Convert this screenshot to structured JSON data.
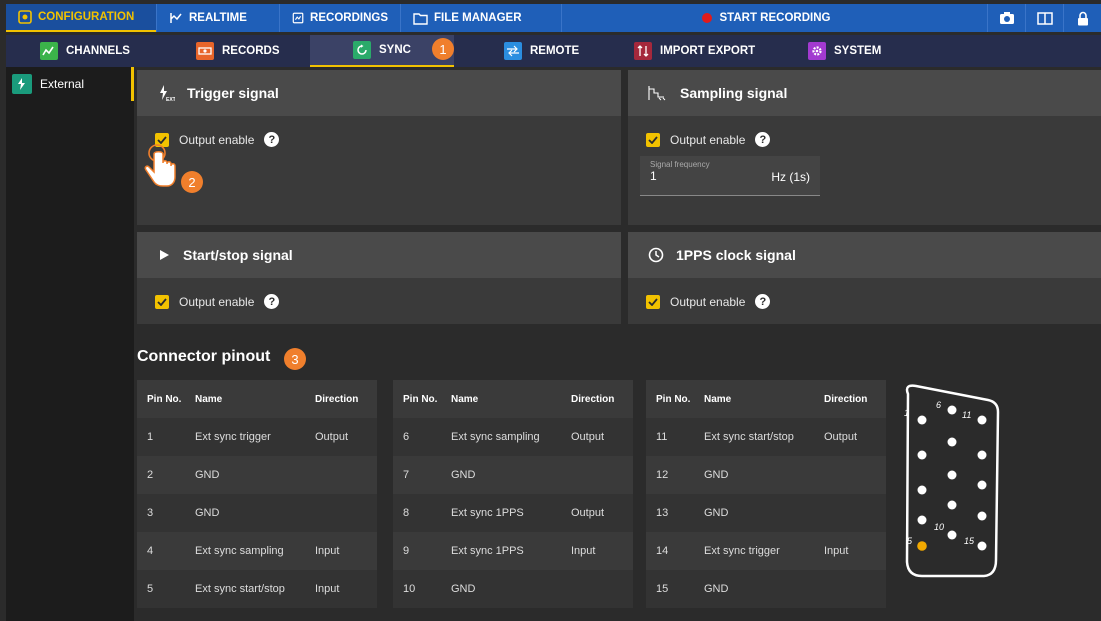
{
  "topnav": {
    "tabs": [
      {
        "label": "CONFIGURATION",
        "icon": "gear-box-icon"
      },
      {
        "label": "REALTIME",
        "icon": "realtime-icon"
      },
      {
        "label": "RECORDINGS",
        "icon": "recordings-icon"
      },
      {
        "label": "FILE MANAGER",
        "icon": "folder-icon"
      }
    ],
    "record_label": "START RECORDING",
    "right_icons": [
      "camera-icon",
      "book-icon",
      "lock-icon"
    ]
  },
  "subnav": {
    "tabs": [
      {
        "label": "CHANNELS",
        "icon": "channels-icon",
        "color": "#3bb34a"
      },
      {
        "label": "RECORDS",
        "icon": "records-icon",
        "color": "#e8652a"
      },
      {
        "label": "SYNC",
        "icon": "sync-icon",
        "color": "#2aaa6a"
      },
      {
        "label": "REMOTE",
        "icon": "remote-icon",
        "color": "#2b8ee0"
      },
      {
        "label": "IMPORT EXPORT",
        "icon": "import-export-icon",
        "color": "#a5283c"
      },
      {
        "label": "SYSTEM",
        "icon": "system-gear-icon",
        "color": "#a23ad0"
      }
    ]
  },
  "sidebar": {
    "items": [
      {
        "label": "External",
        "icon": "ext-icon"
      }
    ]
  },
  "panels": {
    "trigger": {
      "title": "Trigger signal",
      "output_label": "Output enable"
    },
    "sampling": {
      "title": "Sampling signal",
      "output_label": "Output enable",
      "freq_label": "Signal frequency",
      "freq_value": "1",
      "freq_unit": "Hz (1s)"
    },
    "startstop": {
      "title": "Start/stop signal",
      "output_label": "Output enable"
    },
    "pps": {
      "title": "1PPS clock signal",
      "output_label": "Output enable"
    }
  },
  "annotations": {
    "badge1": "1",
    "badge2": "2",
    "badge3": "3"
  },
  "pinout": {
    "title": "Connector pinout",
    "headers": {
      "pin": "Pin No.",
      "name": "Name",
      "direction": "Direction"
    },
    "tables": [
      [
        {
          "pin": "1",
          "name": "Ext sync trigger",
          "dir": "Output"
        },
        {
          "pin": "2",
          "name": "GND",
          "dir": ""
        },
        {
          "pin": "3",
          "name": "GND",
          "dir": ""
        },
        {
          "pin": "4",
          "name": "Ext sync sampling",
          "dir": "Input"
        },
        {
          "pin": "5",
          "name": "Ext sync start/stop",
          "dir": "Input"
        }
      ],
      [
        {
          "pin": "6",
          "name": "Ext sync sampling",
          "dir": "Output"
        },
        {
          "pin": "7",
          "name": "GND",
          "dir": ""
        },
        {
          "pin": "8",
          "name": "Ext sync 1PPS",
          "dir": "Output"
        },
        {
          "pin": "9",
          "name": "Ext sync 1PPS",
          "dir": "Input"
        },
        {
          "pin": "10",
          "name": "GND",
          "dir": ""
        }
      ],
      [
        {
          "pin": "11",
          "name": "Ext sync start/stop",
          "dir": "Output"
        },
        {
          "pin": "12",
          "name": "GND",
          "dir": ""
        },
        {
          "pin": "13",
          "name": "GND",
          "dir": ""
        },
        {
          "pin": "14",
          "name": "Ext sync trigger",
          "dir": "Input"
        },
        {
          "pin": "15",
          "name": "GND",
          "dir": ""
        }
      ]
    ],
    "connector_labels": [
      "1",
      "6",
      "11",
      "10",
      "5",
      "15"
    ]
  },
  "colors": {
    "accent": "#f2c200",
    "topbar": "#1f5fb8",
    "subbar": "#262d4d",
    "badge": "#f07f2c",
    "highlight_pin": "#f2a900"
  }
}
